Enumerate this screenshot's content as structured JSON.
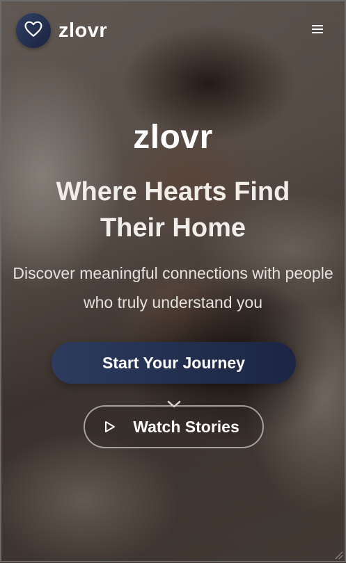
{
  "header": {
    "brand_name": "zlovr",
    "logo_icon": "heart-icon",
    "menu_icon": "hamburger-menu-icon"
  },
  "hero": {
    "logo_text": "zlovr",
    "title": "Where Hearts Find Their Home",
    "subtitle": "Discover meaningful connections with people who truly understand you"
  },
  "actions": {
    "primary_label": "Start Your Journey",
    "secondary_label": "Watch Stories",
    "secondary_icon": "play-icon",
    "scroll_icon": "chevron-down-icon"
  },
  "colors": {
    "primary_button": "#2c3b5e",
    "logo_badge": "#2f3f63",
    "text": "#ffffff"
  }
}
